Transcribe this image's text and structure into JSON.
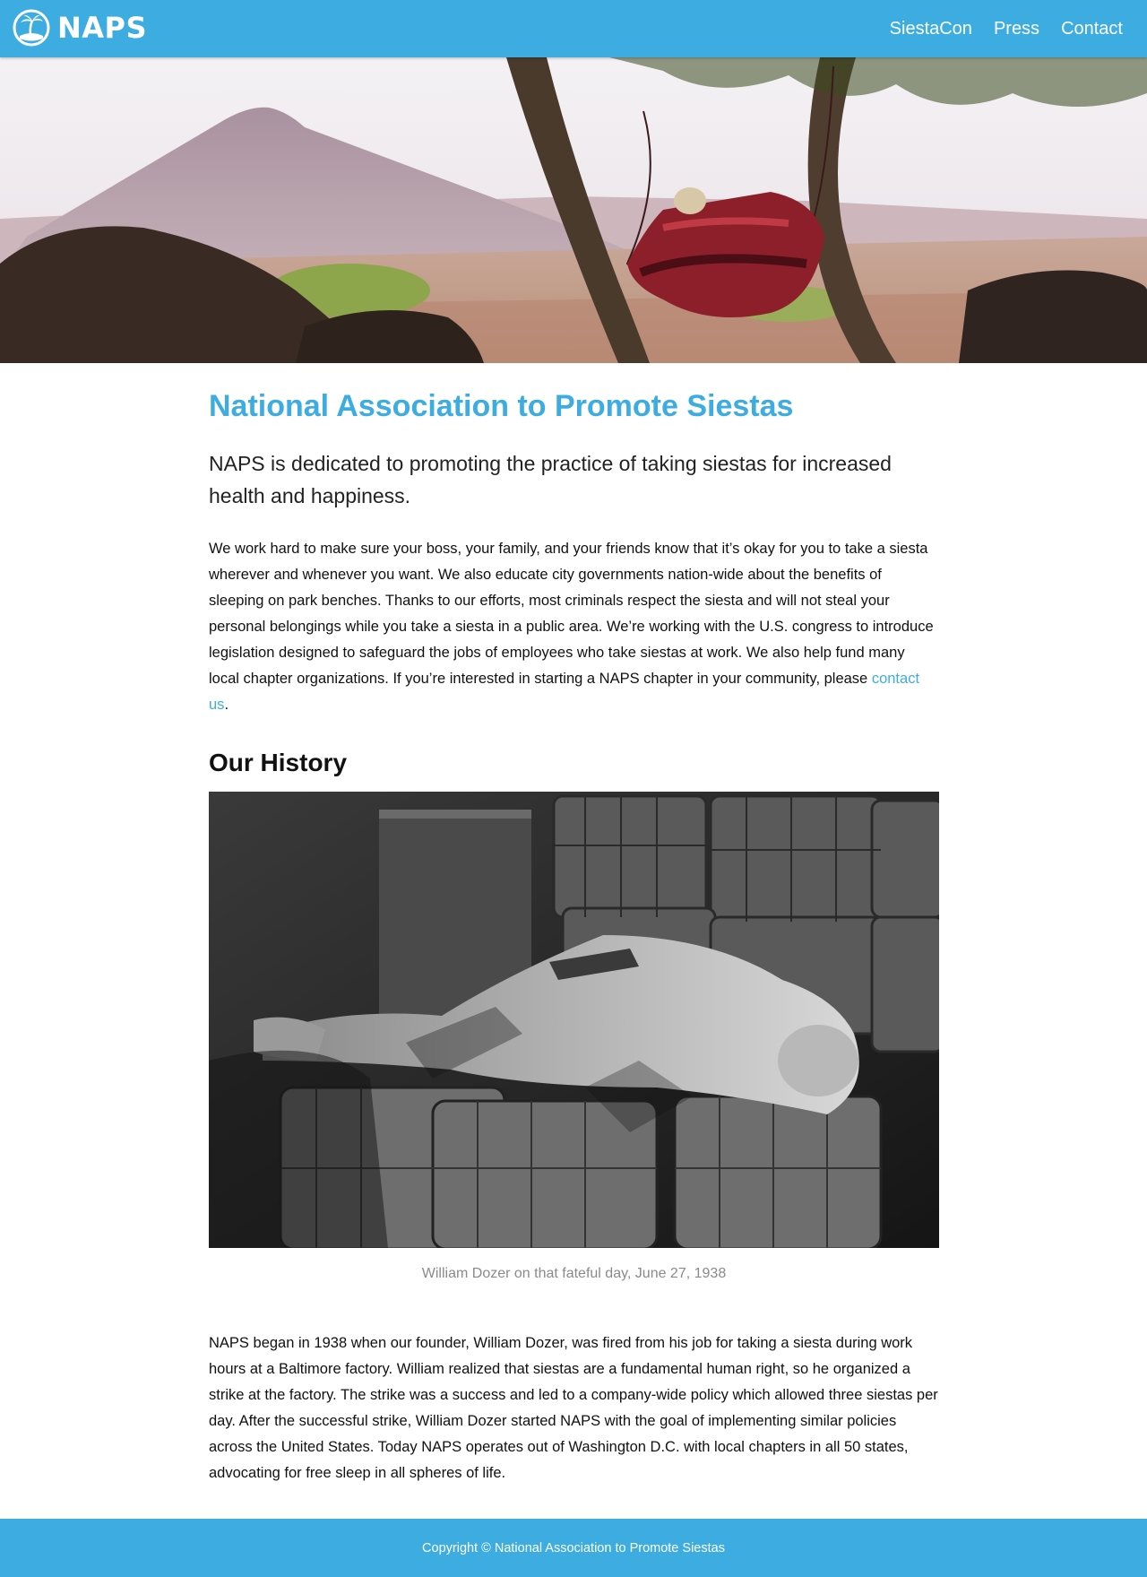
{
  "header": {
    "logo_text": "NAPS",
    "logo_icon": "palm-island-icon",
    "nav": [
      {
        "label": "SiestaCon"
      },
      {
        "label": "Press"
      },
      {
        "label": "Contact"
      }
    ]
  },
  "hero": {
    "image": "hammock-volcano-photo"
  },
  "main": {
    "title": "National Association to Promote Siestas",
    "lead": "NAPS is dedicated to promoting the practice of taking siestas for increased health and happiness.",
    "intro_text": "We work hard to make sure your boss, your family, and your friends know that it’s okay for you to take a siesta wherever and whenever you want. We also educate city governments nation-wide about the benefits of sleeping on park benches. Thanks to our efforts, most criminals respect the siesta and will not steal your personal belongings while you take a siesta in a public area. We’re working with the U.S. congress to introduce legislation designed to safeguard the jobs of employees who take siestas at work. We also help fund many local chapter organizations. If you’re interested in starting a NAPS chapter in your community, please ",
    "intro_link": "contact us",
    "intro_end": ".",
    "history_heading": "Our History",
    "history_image": "man-sleeping-on-baskets-photo",
    "history_caption": "William Dozer on that fateful day, June 27, 1938",
    "history_text": "NAPS began in 1938 when our founder, William Dozer, was fired from his job for taking a siesta during work hours at a Baltimore factory. William realized that siestas are a fundamental human right, so he organized a strike at the factory. The strike was a success and led to a company-wide policy which allowed three siestas per day. After the successful strike, William Dozer started NAPS with the goal of implementing similar policies across the United States. Today NAPS operates out of Washington D.C. with local chapters in all 50 states, advocating for free sleep in all spheres of life."
  },
  "footer": {
    "copyright": "Copyright © National Association to Promote Siestas"
  },
  "colors": {
    "brand": "#3dace1",
    "text": "#111111",
    "caption": "#8a8a8a"
  }
}
